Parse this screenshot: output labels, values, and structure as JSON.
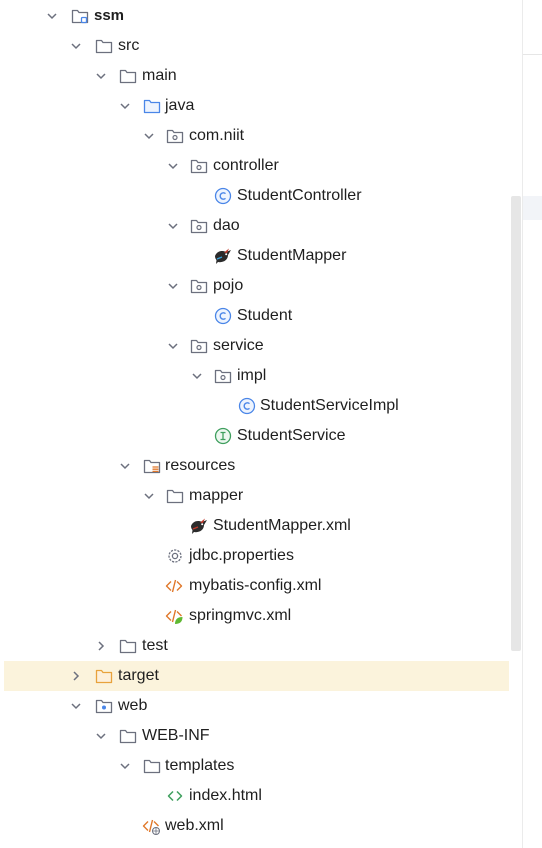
{
  "tree": {
    "items": [
      {
        "label": "ssm",
        "icon": "module-folder-icon",
        "expanded": true,
        "bold": true
      },
      {
        "label": "src",
        "icon": "folder-icon",
        "expanded": true
      },
      {
        "label": "main",
        "icon": "folder-icon",
        "expanded": true
      },
      {
        "label": "java",
        "icon": "source-folder-icon",
        "expanded": true
      },
      {
        "label": "com.niit",
        "icon": "package-icon",
        "expanded": true
      },
      {
        "label": "controller",
        "icon": "package-icon",
        "expanded": true
      },
      {
        "label": "StudentController",
        "icon": "class-icon"
      },
      {
        "label": "dao",
        "icon": "package-icon",
        "expanded": true
      },
      {
        "label": "StudentMapper",
        "icon": "mybatis-bird-icon"
      },
      {
        "label": "pojo",
        "icon": "package-icon",
        "expanded": true
      },
      {
        "label": "Student",
        "icon": "class-icon"
      },
      {
        "label": "service",
        "icon": "package-icon",
        "expanded": true
      },
      {
        "label": "impl",
        "icon": "package-icon",
        "expanded": true
      },
      {
        "label": "StudentServiceImpl",
        "icon": "class-icon"
      },
      {
        "label": "StudentService",
        "icon": "interface-icon"
      },
      {
        "label": "resources",
        "icon": "resources-folder-icon",
        "expanded": true
      },
      {
        "label": "mapper",
        "icon": "folder-icon",
        "expanded": true
      },
      {
        "label": "StudentMapper.xml",
        "icon": "mybatis-xml-icon"
      },
      {
        "label": "jdbc.properties",
        "icon": "properties-gear-icon"
      },
      {
        "label": "mybatis-config.xml",
        "icon": "xml-icon"
      },
      {
        "label": "springmvc.xml",
        "icon": "spring-xml-icon"
      },
      {
        "label": "test",
        "icon": "folder-icon",
        "expanded": false
      },
      {
        "label": "target",
        "icon": "excluded-folder-icon",
        "expanded": false,
        "selected": true
      },
      {
        "label": "web",
        "icon": "web-folder-icon",
        "expanded": true
      },
      {
        "label": "WEB-INF",
        "icon": "folder-icon",
        "expanded": true
      },
      {
        "label": "templates",
        "icon": "folder-icon",
        "expanded": true
      },
      {
        "label": "index.html",
        "icon": "html-icon"
      },
      {
        "label": "web.xml",
        "icon": "web-xml-icon"
      }
    ]
  },
  "colors": {
    "selection": "#fbf3dc",
    "class_blue": "#4a86e8",
    "interface_green": "#3f9f5e",
    "xml_orange": "#e0772a",
    "target_orange": "#e8a23c",
    "folder_gray": "#6c707e"
  }
}
